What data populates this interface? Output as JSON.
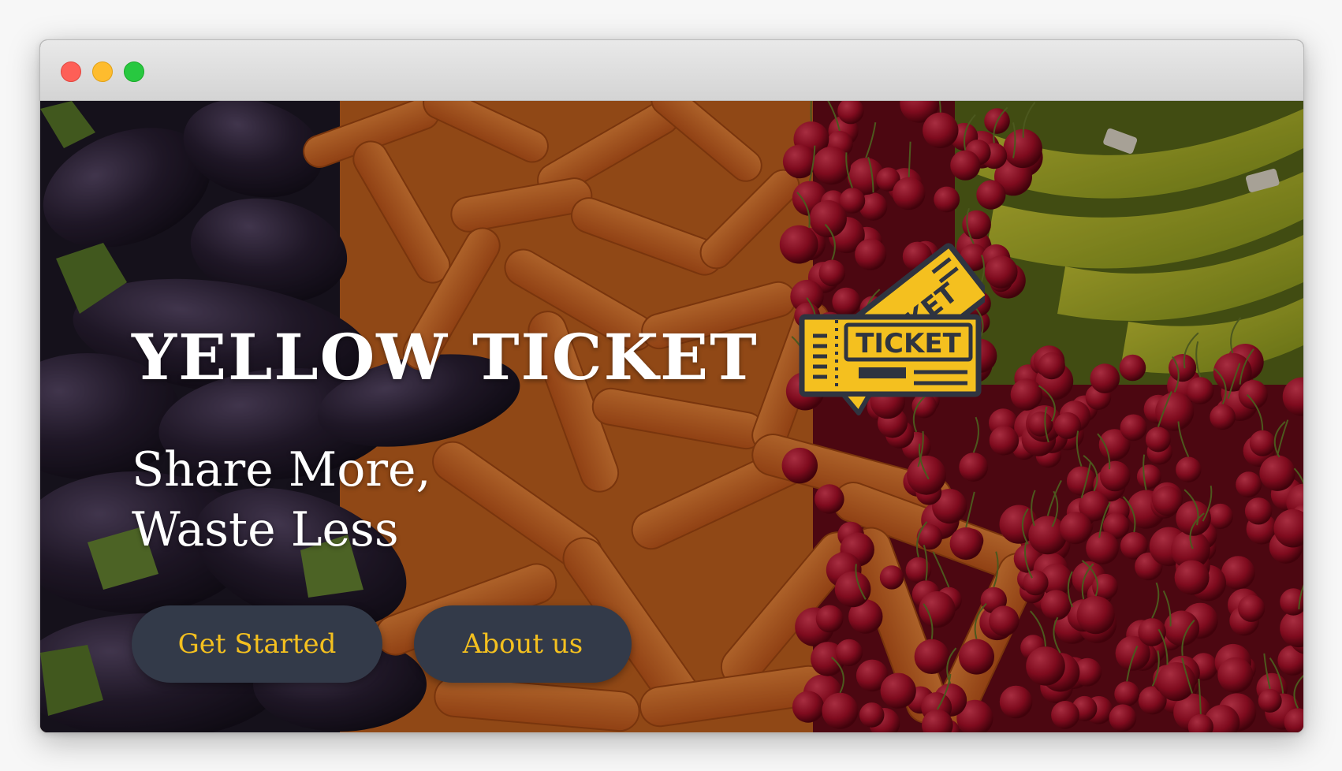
{
  "window": {
    "traffic_lights": [
      "close",
      "minimize",
      "zoom"
    ]
  },
  "hero": {
    "background": "produce-photo: eggplants, carrots, cherries, bananas",
    "title": "YELLOW TICKET",
    "logo_text": "TICKET",
    "logo_back_text": "CKET",
    "tagline_line1": "Share More,",
    "tagline_line2": "Waste Less"
  },
  "buttons": {
    "get_started": "Get Started",
    "about_us": "About us"
  },
  "colors": {
    "button_bg": "#333a49",
    "button_text": "#f4c01f",
    "logo_yellow": "#f4c01f",
    "logo_outline": "#2f3440",
    "title_text": "#ffffff"
  }
}
